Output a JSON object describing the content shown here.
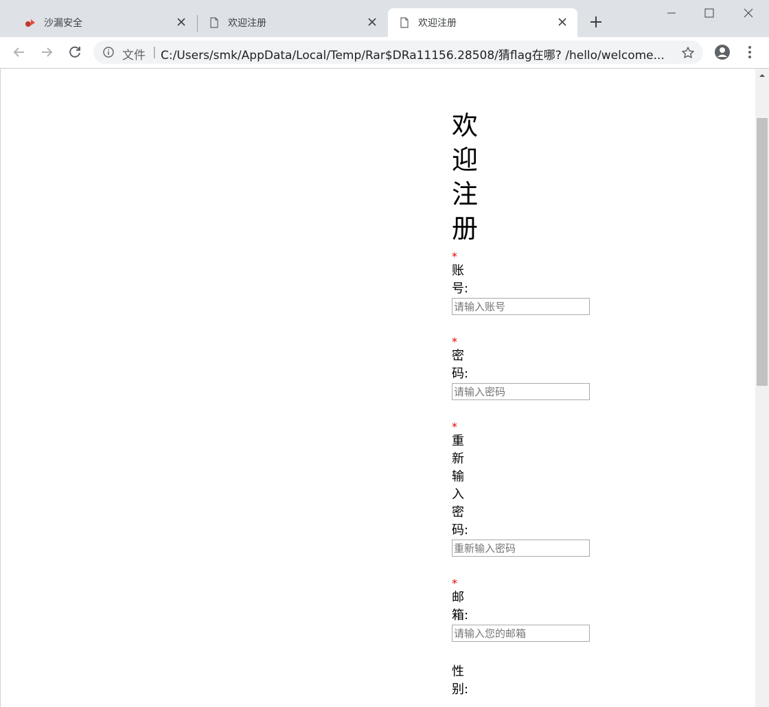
{
  "tabs": [
    {
      "title": "沙漏安全",
      "icon": "brand-logo-icon"
    },
    {
      "title": "欢迎注册",
      "icon": "page-icon"
    },
    {
      "title": "欢迎注册",
      "icon": "page-icon",
      "active": true
    }
  ],
  "toolbar": {
    "scheme_label": "文件",
    "scheme_separator": "|",
    "url": "C:/Users/smk/AppData/Local/Temp/Rar$DRa11156.28508/猜flag在哪? /hello/welcome..."
  },
  "page": {
    "heading": "欢迎注册",
    "required_mark": "*",
    "fields": [
      {
        "label": "账号:",
        "placeholder": "请输入账号",
        "required": true
      },
      {
        "label": "密码:",
        "placeholder": "请输入密码",
        "required": true
      },
      {
        "label": "重新输入密码:",
        "placeholder": "重新输入密码",
        "required": true
      },
      {
        "label": "邮箱:",
        "placeholder": "请输入您的邮箱",
        "required": true
      },
      {
        "label": "性别:",
        "required": false
      }
    ]
  },
  "colors": {
    "tabstrip": "#dee1e6",
    "required": "#e00000",
    "text": "#000000"
  }
}
